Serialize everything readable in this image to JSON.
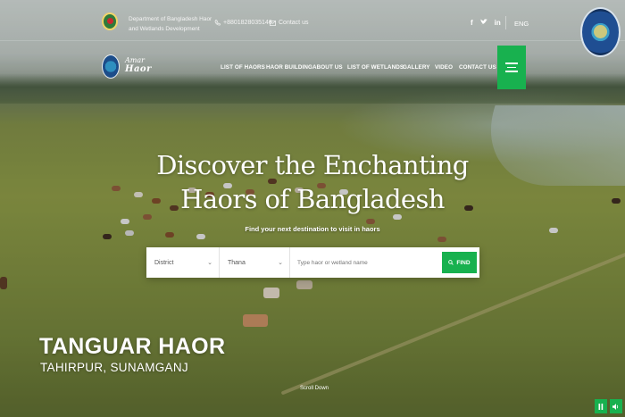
{
  "topbar": {
    "dept_name": "Department of Bangladesh Haor and Wetlands Development",
    "phone": "+8801828035146",
    "contact": "Contact us",
    "social": [
      "f",
      "t",
      "in"
    ],
    "language": "ENG"
  },
  "nav": {
    "brand_line1": "Amar",
    "brand_line2": "Haor",
    "items": [
      "LIST OF HAORS",
      "HAOR BUILDING",
      "ABOUT US",
      "LIST OF WETLANDS",
      "GALLERY",
      "VIDEO",
      "CONTACT US"
    ]
  },
  "hero": {
    "headline_line1": "Discover the Enchanting",
    "headline_line2": "Haors of Bangladesh",
    "subhead": "Find your next destination to visit in haors"
  },
  "search": {
    "district": "District",
    "thana": "Thana",
    "placeholder": "Type haor or wetland name",
    "find_label": "FIND"
  },
  "caption": {
    "title": "TANGUAR HAOR",
    "subtitle": "TAHIRPUR, SUNAMGANJ",
    "scroll": "Scroll Down"
  },
  "colors": {
    "accent": "#18b14f"
  },
  "icons": [
    "phone-icon",
    "mail-icon",
    "facebook-icon",
    "twitter-icon",
    "linkedin-icon",
    "menu-icon",
    "search-icon",
    "pause-icon",
    "sound-icon"
  ]
}
